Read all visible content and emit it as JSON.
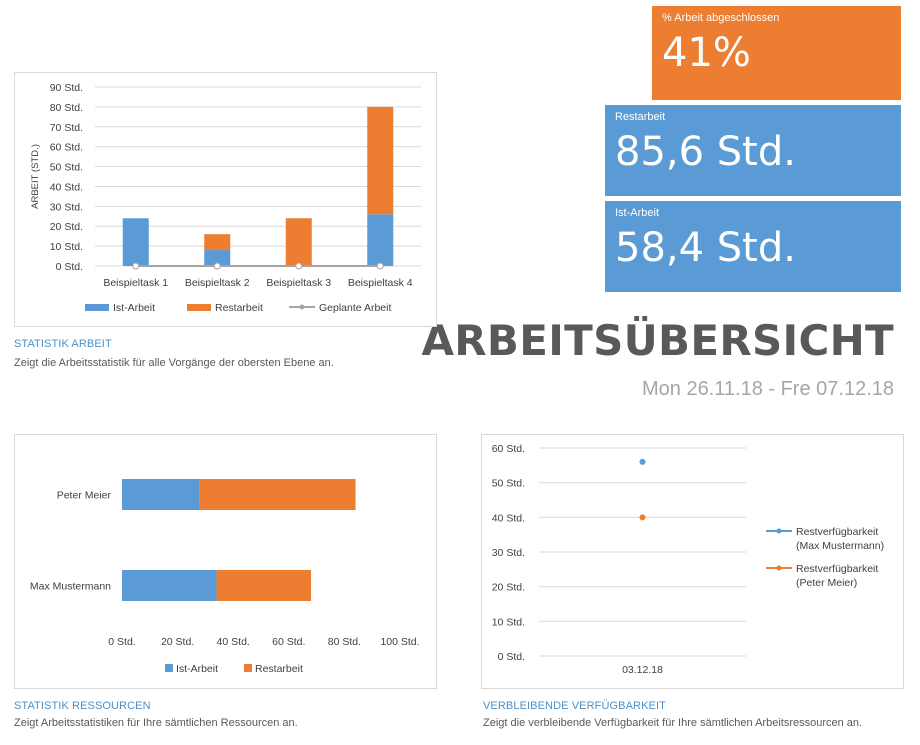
{
  "kpis": {
    "percent_label": "% Arbeit abgeschlossen",
    "percent_value": "41%",
    "rest_label": "Restarbeit",
    "rest_value": "85,6 Std.",
    "ist_label": "Ist-Arbeit",
    "ist_value": "58,4 Std."
  },
  "header": {
    "title": "ARBEITSÜBERSICHT",
    "date_range": "Mon 26.11.18 - Fre 07.12.18"
  },
  "sections": {
    "work_title": "STATISTIK ARBEIT",
    "work_desc": "Zeigt die Arbeitsstatistik für alle Vorgänge der obersten Ebene an.",
    "res_title": "STATISTIK RESSOURCEN",
    "res_desc": "Zeigt Arbeitsstatistiken für Ihre sämtlichen Ressourcen an.",
    "avail_title": "VERBLEIBENDE VERFÜGBARKEIT",
    "avail_desc": "Zeigt die verbleibende Verfügbarkeit für Ihre sämtlichen Arbeitsressourcen an."
  },
  "colors": {
    "ist": "#5b9bd5",
    "rest": "#ed7d31",
    "planned": "#a5a5a5",
    "grid": "#d9d9d9",
    "axis_text": "#404040"
  },
  "chart_data": [
    {
      "id": "work",
      "type": "bar",
      "stacked": true,
      "orientation": "vertical",
      "categories": [
        "Beispieltask 1",
        "Beispieltask 2",
        "Beispieltask 3",
        "Beispieltask 4"
      ],
      "series": [
        {
          "name": "Ist-Arbeit",
          "values": [
            24,
            8,
            0,
            26
          ],
          "color": "#5b9bd5"
        },
        {
          "name": "Restarbeit",
          "values": [
            0,
            8,
            24,
            54
          ],
          "color": "#ed7d31"
        },
        {
          "name": "Geplante Arbeit",
          "values": [
            0,
            0,
            0,
            0
          ],
          "color": "#a5a5a5",
          "kind": "line"
        }
      ],
      "ylabel": "ARBEIT (STD.)",
      "ylim": [
        0,
        90
      ],
      "yticks": [
        "0 Std.",
        "10 Std.",
        "20 Std.",
        "30 Std.",
        "40 Std.",
        "50 Std.",
        "60 Std.",
        "70 Std.",
        "80 Std.",
        "90 Std."
      ],
      "grid": true,
      "legend": "bottom"
    },
    {
      "id": "resources",
      "type": "bar",
      "stacked": true,
      "orientation": "horizontal",
      "categories": [
        "Max Mustermann",
        "Peter Meier"
      ],
      "series": [
        {
          "name": "Ist-Arbeit",
          "values": [
            34,
            28
          ],
          "color": "#5b9bd5"
        },
        {
          "name": "Restarbeit",
          "values": [
            34,
            56
          ],
          "color": "#ed7d31"
        }
      ],
      "xlim": [
        0,
        100
      ],
      "xticks": [
        "0 Std.",
        "20 Std.",
        "40 Std.",
        "60 Std.",
        "80 Std.",
        "100 Std."
      ],
      "grid": false,
      "legend": "bottom"
    },
    {
      "id": "availability",
      "type": "scatter",
      "categories": [
        "03.12.18"
      ],
      "series": [
        {
          "name": "Restverfügbarkeit (Max Mustermann)",
          "label_lines": [
            "Restverfügbarkeit",
            "(Max Mustermann)"
          ],
          "values": [
            56
          ],
          "color": "#5b9bd5"
        },
        {
          "name": "Restverfügbarkeit (Peter Meier)",
          "label_lines": [
            "Restverfügbarkeit",
            "(Peter Meier)"
          ],
          "values": [
            40
          ],
          "color": "#ed7d31"
        }
      ],
      "ylim": [
        0,
        60
      ],
      "yticks": [
        "0 Std.",
        "10 Std.",
        "20 Std.",
        "30 Std.",
        "40 Std.",
        "50 Std.",
        "60 Std."
      ],
      "grid": true,
      "legend": "right"
    }
  ]
}
